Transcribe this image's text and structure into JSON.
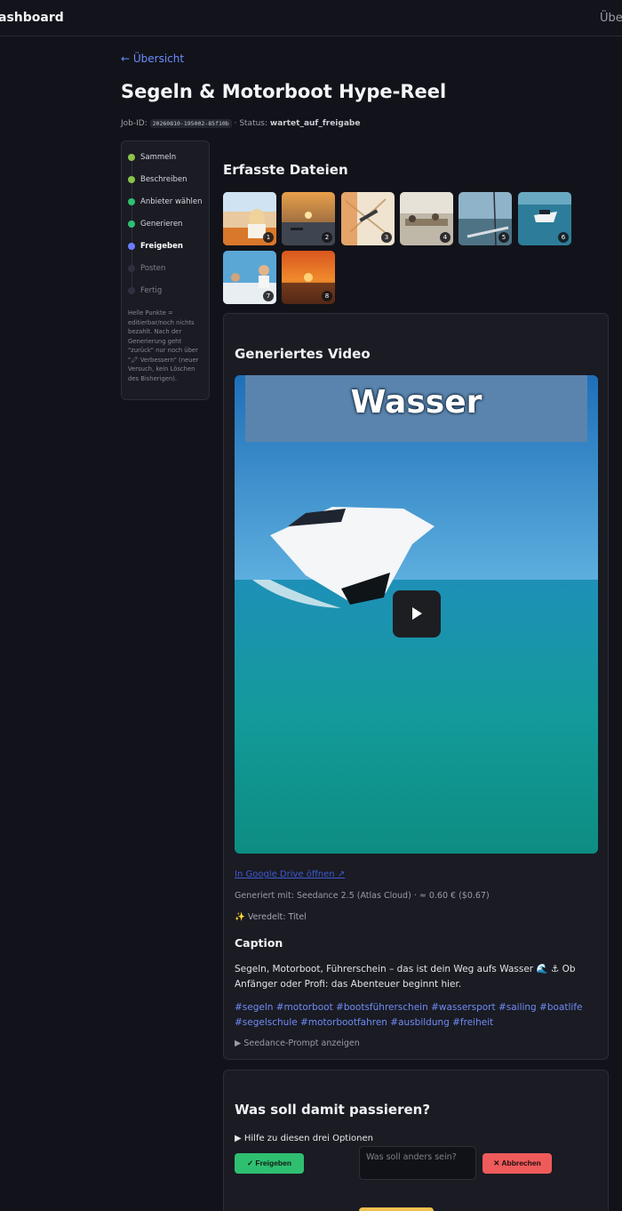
{
  "topbar": {
    "brand": "ashboard",
    "nav_item": "Übers"
  },
  "back_link": "← Übersicht",
  "page_title": "Segeln & Motorboot Hype-Reel",
  "job": {
    "id_label": "Job-ID:",
    "id": "20260810-195002-85f10b",
    "status_label": "· Status:",
    "status": "wartet_auf_freigabe"
  },
  "steps": {
    "items": [
      {
        "label": "Sammeln",
        "state": "done",
        "color": "#8bc34a"
      },
      {
        "label": "Beschreiben",
        "state": "done",
        "color": "#8bc34a"
      },
      {
        "label": "Anbieter wählen",
        "state": "done",
        "color": "#2fbf71"
      },
      {
        "label": "Generieren",
        "state": "done",
        "color": "#2fbf71"
      },
      {
        "label": "Freigeben",
        "state": "active",
        "color": "#6b7cff"
      },
      {
        "label": "Posten",
        "state": "todo",
        "color": "#2e3040"
      },
      {
        "label": "Fertig",
        "state": "todo",
        "color": "#2e3040"
      }
    ],
    "hint": "Helle Punkte = editierbar/noch nichts bezahlt. Nach der Generierung geht \"zurück\" nur noch über \"🖍 Verbessern\" (neuer Versuch, kein Löschen des Bisherigen)."
  },
  "files": {
    "title": "Erfasste Dateien",
    "thumbs": [
      {
        "n": "1",
        "icon": "photo-girl-sailing"
      },
      {
        "n": "2",
        "icon": "photo-sunset-boat"
      },
      {
        "n": "3",
        "icon": "photo-nautical-chart"
      },
      {
        "n": "4",
        "icon": "photo-classroom"
      },
      {
        "n": "5",
        "icon": "photo-sailboat-deck"
      },
      {
        "n": "6",
        "icon": "photo-motorboat"
      },
      {
        "n": "7",
        "icon": "photo-people-on-boat"
      },
      {
        "n": "8",
        "icon": "photo-orange-sunset"
      }
    ]
  },
  "video": {
    "title": "Generiertes Video",
    "overlay_text": "Wasser",
    "drive_link": "In Google Drive öffnen ↗",
    "generated": "Generiert mit: Seedance 2.5 (Atlas Cloud) · ≈ 0.60 € ($0.67)",
    "refined": "✨ Veredelt: Titel",
    "caption_title": "Caption",
    "caption_text": "Segeln, Motorboot, Führerschein – das ist dein Weg aufs Wasser 🌊 ⚓ Ob Anfänger oder Profi: das Abenteuer beginnt hier.",
    "hashtags": "#segeln #motorboot #bootsführerschein #wassersport #sailing #boatlife #segelschule #motorbootfahren #ausbildung #freiheit",
    "prompt_toggle": "▶ Seedance-Prompt anzeigen"
  },
  "actions": {
    "title": "Was soll damit passieren?",
    "help_toggle": "▶ Hilfe zu diesen drei Optionen",
    "approve_label": "✓ Freigeben",
    "feedback_placeholder": "Was soll anders sein?",
    "cancel_label": "✕ Abbrechen"
  }
}
